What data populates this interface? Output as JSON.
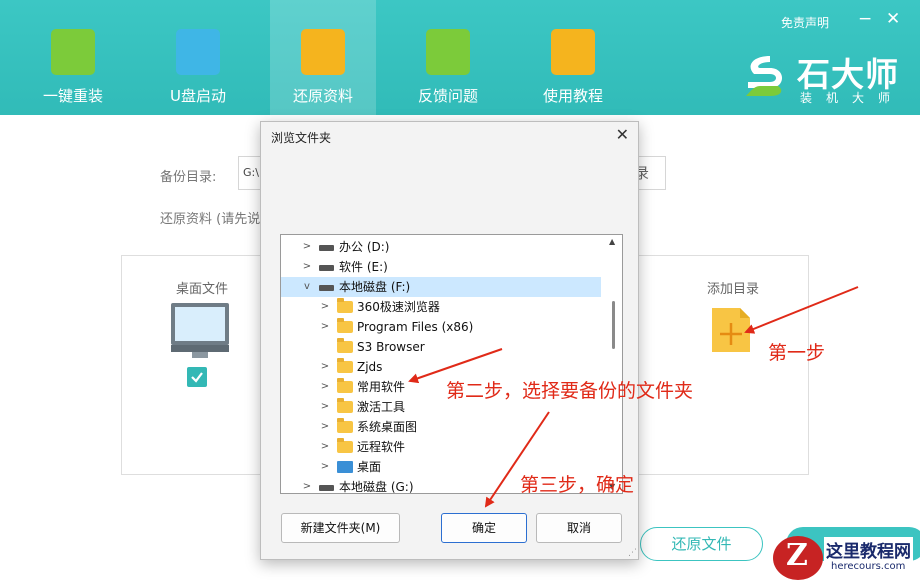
{
  "header": {
    "tabs": [
      {
        "label": "一键重装",
        "icon": "chart-bars-icon",
        "color": "#7ccb3a"
      },
      {
        "label": "U盘启动",
        "icon": "usb-lightning-icon",
        "color": "#3fb6e6"
      },
      {
        "label": "还原资料",
        "icon": "upload-box-icon",
        "color": "#f5b41e",
        "active": true
      },
      {
        "label": "反馈问题",
        "icon": "envelope-icon",
        "color": "#7ccb3a"
      },
      {
        "label": "使用教程",
        "icon": "book-icon",
        "color": "#f5b41e"
      }
    ],
    "disclaimer": "免责声明",
    "minimize": "−",
    "close": "✕",
    "brand": {
      "name": "石大师",
      "sub": "装机大师"
    }
  },
  "background": {
    "backup_dir_label": "备份目录:",
    "backup_path": "G:\\",
    "browse_fragment": "录",
    "restore_hint": "还原资料 (请先说",
    "desktop_files_label": "桌面文件",
    "add_dir_label": "添加目录",
    "restore_button": "还原文件"
  },
  "dialog": {
    "title": "浏览文件夹",
    "close": "✕",
    "tree": [
      {
        "name": "办公 (D:)",
        "type": "drive",
        "level": 0,
        "chevron": ">"
      },
      {
        "name": "软件 (E:)",
        "type": "drive",
        "level": 0,
        "chevron": ">"
      },
      {
        "name": "本地磁盘 (F:)",
        "type": "drive",
        "level": 0,
        "chevron": "v",
        "selected": true
      },
      {
        "name": "360极速浏览器",
        "type": "folder",
        "level": 1,
        "chevron": ">"
      },
      {
        "name": "Program Files (x86)",
        "type": "folder",
        "level": 1,
        "chevron": ">"
      },
      {
        "name": "S3 Browser",
        "type": "folder",
        "level": 1,
        "chevron": ""
      },
      {
        "name": "Zjds",
        "type": "folder",
        "level": 1,
        "chevron": ">"
      },
      {
        "name": "常用软件",
        "type": "folder",
        "level": 1,
        "chevron": ">"
      },
      {
        "name": "激活工具",
        "type": "folder",
        "level": 1,
        "chevron": ">"
      },
      {
        "name": "系统桌面图",
        "type": "folder",
        "level": 1,
        "chevron": ">"
      },
      {
        "name": "远程软件",
        "type": "folder",
        "level": 1,
        "chevron": ">"
      },
      {
        "name": "桌面",
        "type": "desktop",
        "level": 1,
        "chevron": ">"
      },
      {
        "name": "本地磁盘 (G:)",
        "type": "drive",
        "level": 0,
        "chevron": ">"
      }
    ],
    "new_folder_button": "新建文件夹(M)",
    "ok_button": "确定",
    "cancel_button": "取消"
  },
  "annotations": {
    "step1": "第一步",
    "step2": "第二步，选择要备份的文件夹",
    "step3": "第三步，确定",
    "color": "#e02a18"
  },
  "watermark": {
    "logo_letter": "Z",
    "title": "这里教程网",
    "url": "herecours.com"
  }
}
